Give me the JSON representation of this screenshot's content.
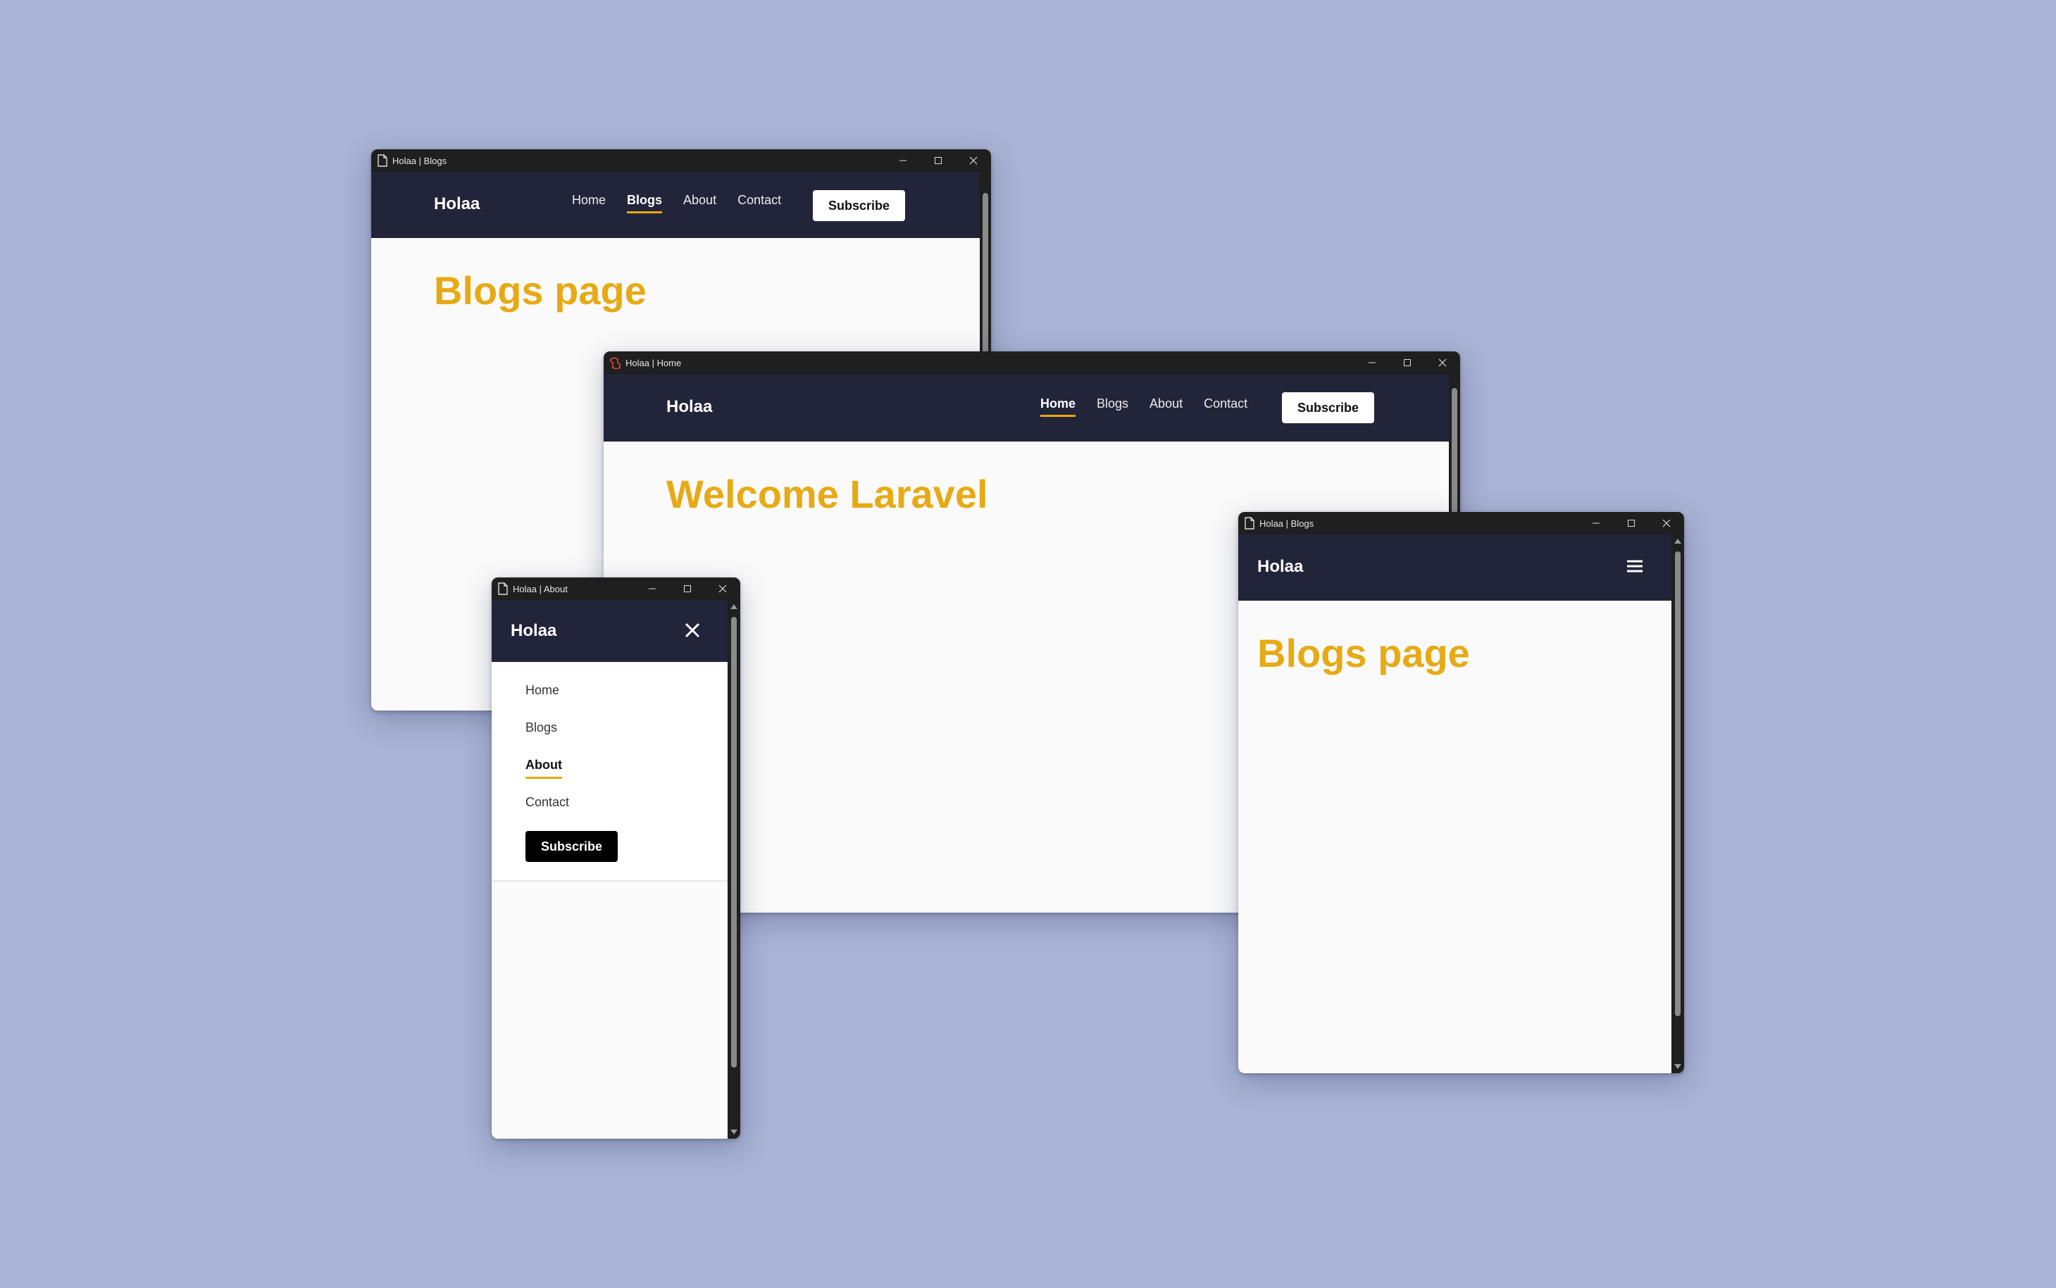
{
  "colors": {
    "background": "#a8b3d5",
    "navbar": "#22243a",
    "accent": "#e7aa14",
    "titlebar": "#1f1f1f"
  },
  "windows": {
    "blogs_large": {
      "title": "Holaa | Blogs",
      "brand": "Holaa",
      "nav": [
        "Home",
        "Blogs",
        "About",
        "Contact"
      ],
      "active": "Blogs",
      "subscribe": "Subscribe",
      "heading": "Blogs page"
    },
    "home": {
      "title": "Holaa | Home",
      "brand": "Holaa",
      "nav": [
        "Home",
        "Blogs",
        "About",
        "Contact"
      ],
      "active": "Home",
      "subscribe": "Subscribe",
      "heading": "Welcome Laravel"
    },
    "about_mobile": {
      "title": "Holaa | About",
      "brand": "Holaa",
      "menu": [
        "Home",
        "Blogs",
        "About",
        "Contact"
      ],
      "active": "About",
      "subscribe": "Subscribe",
      "menu_icon": "close-icon"
    },
    "blogs_mobile": {
      "title": "Holaa | Blogs",
      "brand": "Holaa",
      "menu_icon": "hamburger-icon",
      "heading": "Blogs page"
    }
  }
}
